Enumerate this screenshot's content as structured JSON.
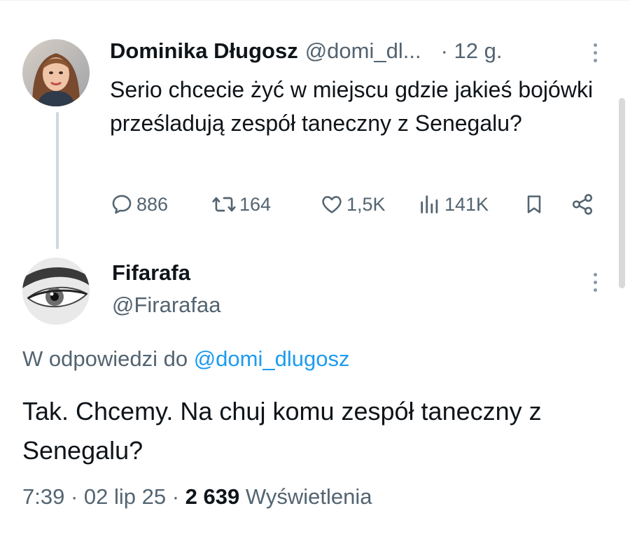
{
  "original_tweet": {
    "author_name": "Dominika Długosz",
    "author_handle": "@domi_dl...",
    "time": "· 12 g.",
    "text": "Serio chcecie żyć w miejscu gdzie jakieś bojówki prześladują zespół taneczny z Senegalu?",
    "actions": {
      "replies": "886",
      "retweets": "164",
      "likes": "1,5K",
      "views": "141K"
    }
  },
  "reply_tweet": {
    "author_name": "Fifarafa",
    "author_handle": "@Firarafaa",
    "replying_prefix": "W odpowiedzi do",
    "replying_to": "@domi_dlugosz",
    "text": "Tak. Chcemy. Na chuj komu zespół taneczny z Senegalu?",
    "time": "7:39 · 02 lip 25 · ",
    "view_count": "2 639",
    "view_label": "Wyświetlenia"
  },
  "colors": {
    "text_primary": "#0f1419",
    "text_secondary": "#536471",
    "link": "#1d9bf0",
    "thread_line": "#cfd9de"
  },
  "icons": [
    "reply-icon",
    "retweet-icon",
    "like-icon",
    "views-icon",
    "bookmark-icon",
    "share-icon",
    "more-icon"
  ]
}
